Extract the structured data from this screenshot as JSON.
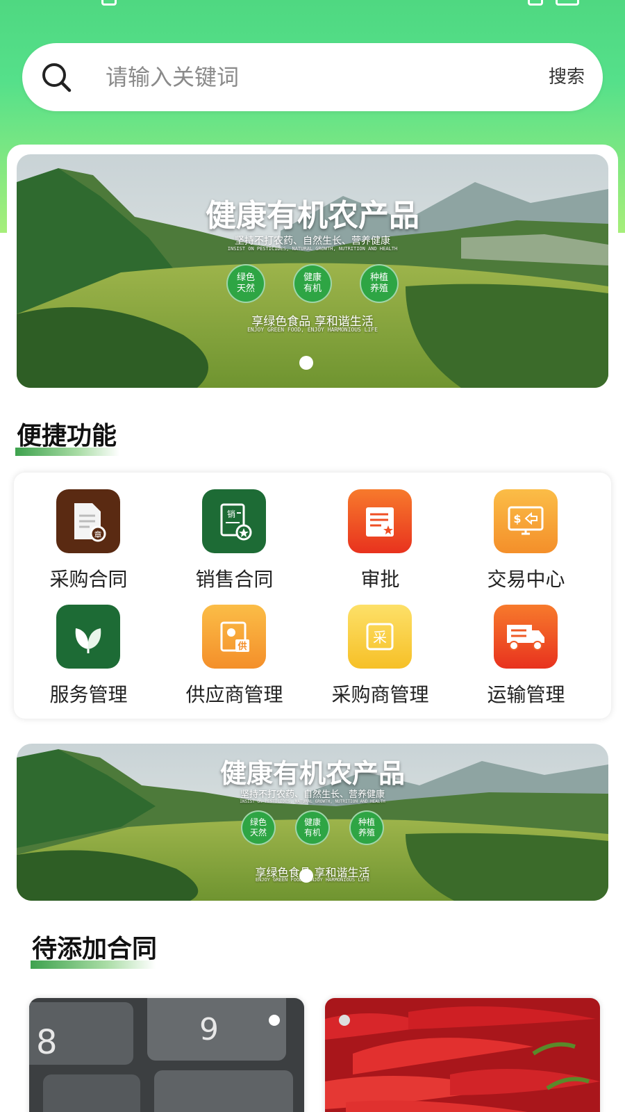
{
  "search": {
    "placeholder": "请输入关键词",
    "button_label": "搜索"
  },
  "banner": {
    "title": "健康有机农产品",
    "subtitle": "坚持不打农药、自然生长、营养健康",
    "subtitle_en": "INSIST ON PESTICIDES, NATURAL GROWTH, NUTRITION AND HEALTH",
    "badges": [
      {
        "line1": "绿色",
        "line2": "天然"
      },
      {
        "line1": "健康",
        "line2": "有机"
      },
      {
        "line1": "种植",
        "line2": "养殖"
      }
    ],
    "slogan": "享绿色食品 享和谐生活",
    "slogan_en": "ENJOY GREEN FOOD, ENJOY HARMONIOUS LIFE"
  },
  "quick_functions": {
    "title": "便捷功能",
    "items": [
      {
        "label": "采购合同",
        "icon": "purchase-contract-icon",
        "color": "#5a2a12"
      },
      {
        "label": "销售合同",
        "icon": "sales-contract-icon",
        "color": "#1d6b35"
      },
      {
        "label": "审批",
        "icon": "approval-icon",
        "color": "#ef4f24"
      },
      {
        "label": "交易中心",
        "icon": "trading-center-icon",
        "color": "#f7a63a"
      },
      {
        "label": "服务管理",
        "icon": "leaf-icon",
        "color": "#1d6b35"
      },
      {
        "label": "供应商管理",
        "icon": "supplier-icon",
        "color": "#f7a63a"
      },
      {
        "label": "采购商管理",
        "icon": "purchaser-icon",
        "color": "#f8c92f"
      },
      {
        "label": "运输管理",
        "icon": "truck-icon",
        "color": "#ef5a26"
      }
    ]
  },
  "pending_contracts": {
    "title": "待添加合同",
    "items": [
      {
        "image": "keyboard-image"
      },
      {
        "image": "chili-peppers-image"
      }
    ]
  },
  "colors": {
    "header_gradient_top": "#4fd881",
    "header_gradient_bottom": "#a6ee7a",
    "accent_green": "#3ea24e"
  }
}
